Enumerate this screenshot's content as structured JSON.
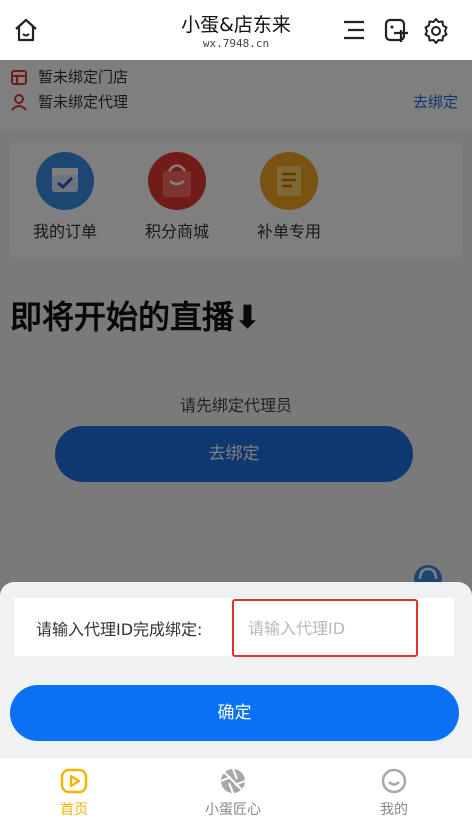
{
  "header": {
    "title": "小蛋&店东来",
    "subtitle": "wx.7948.cn"
  },
  "binding": {
    "store_status": "暂未绑定门店",
    "agent_status": "暂未绑定代理",
    "bind_link": "去绑定"
  },
  "menu": {
    "items": [
      {
        "label": "我的订单",
        "icon": "calendar-check-icon",
        "color": "#3a8ee6"
      },
      {
        "label": "积分商城",
        "icon": "shopping-bag-icon",
        "color": "#e53935"
      },
      {
        "label": "补单专用",
        "icon": "ledger-icon",
        "color": "#f5a623"
      }
    ]
  },
  "live": {
    "title": "即将开始的直播⬇",
    "hint": "请先绑定代理员",
    "bind_button": "去绑定"
  },
  "dialog": {
    "label": "请输入代理ID完成绑定:",
    "input_placeholder": "请输入代理ID",
    "input_value": "",
    "confirm": "确定"
  },
  "tabs": [
    {
      "label": "首页",
      "icon": "play-icon",
      "active": true
    },
    {
      "label": "小蛋匠心",
      "icon": "aperture-icon",
      "active": false
    },
    {
      "label": "我的",
      "icon": "smile-icon",
      "active": false
    }
  ],
  "colors": {
    "accent": "#0a71f5",
    "tab_active": "#f5b400",
    "highlight_border": "#e0342b"
  }
}
